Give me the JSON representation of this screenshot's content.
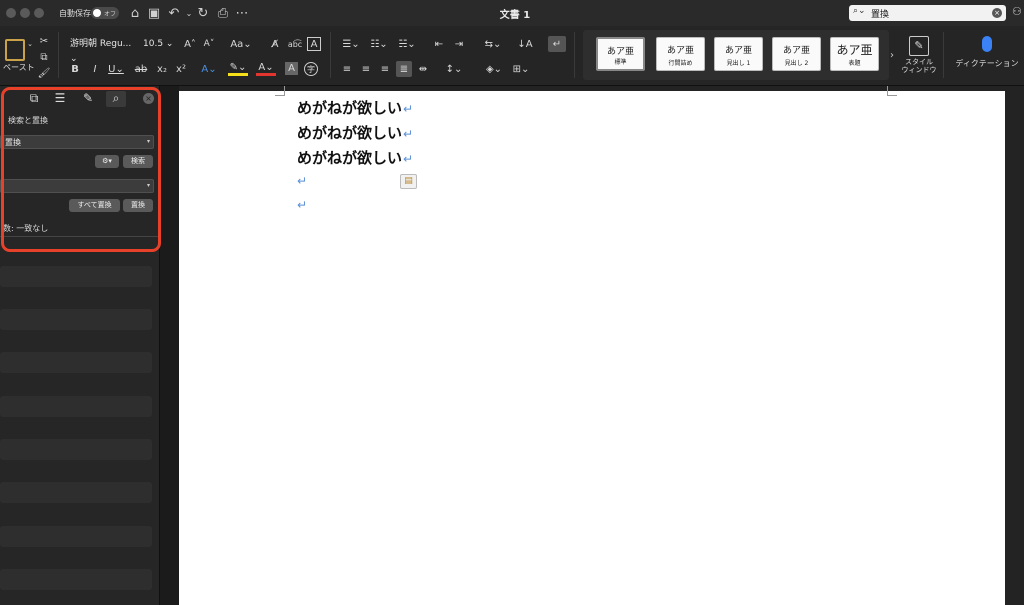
{
  "titlebar": {
    "autosave_label": "自動保存",
    "autosave_state": "オフ",
    "doc_title": "文書 1",
    "search_value": "置換",
    "icons": [
      "home-icon",
      "save-icon",
      "undo-icon",
      "redo-icon",
      "print-icon",
      "more-icon"
    ]
  },
  "ribbon": {
    "paste_label": "ペースト",
    "font_name": "游明朝 Regu...",
    "font_size": "10.5",
    "styles": [
      {
        "sample": "あア亜",
        "name": "標準"
      },
      {
        "sample": "あア亜",
        "name": "行間詰め"
      },
      {
        "sample": "あア亜",
        "name": "見出し 1"
      },
      {
        "sample": "あア亜",
        "name": "見出し 2"
      },
      {
        "sample": "あア亜",
        "name": "表題"
      }
    ],
    "style_window_label_1": "スタイル",
    "style_window_label_2": "ウィンドウ",
    "dictation_label": "ディクテーション",
    "colors": {
      "highlight": "#f5e01a",
      "font_color": "#e3342f",
      "accent": "#3b82f6"
    }
  },
  "find_panel": {
    "heading": "検索と置換",
    "search_value": "置換",
    "search_button": "検索",
    "replace_value": "",
    "replace_all_button": "すべて置換",
    "replace_button": "置換",
    "result": "数: 一致なし",
    "highlight_color": "#e8412a"
  },
  "document": {
    "lines": [
      "めがねが欲しい",
      "めがねが欲しい",
      "めがねが欲しい"
    ],
    "pilcrow": "↵"
  }
}
